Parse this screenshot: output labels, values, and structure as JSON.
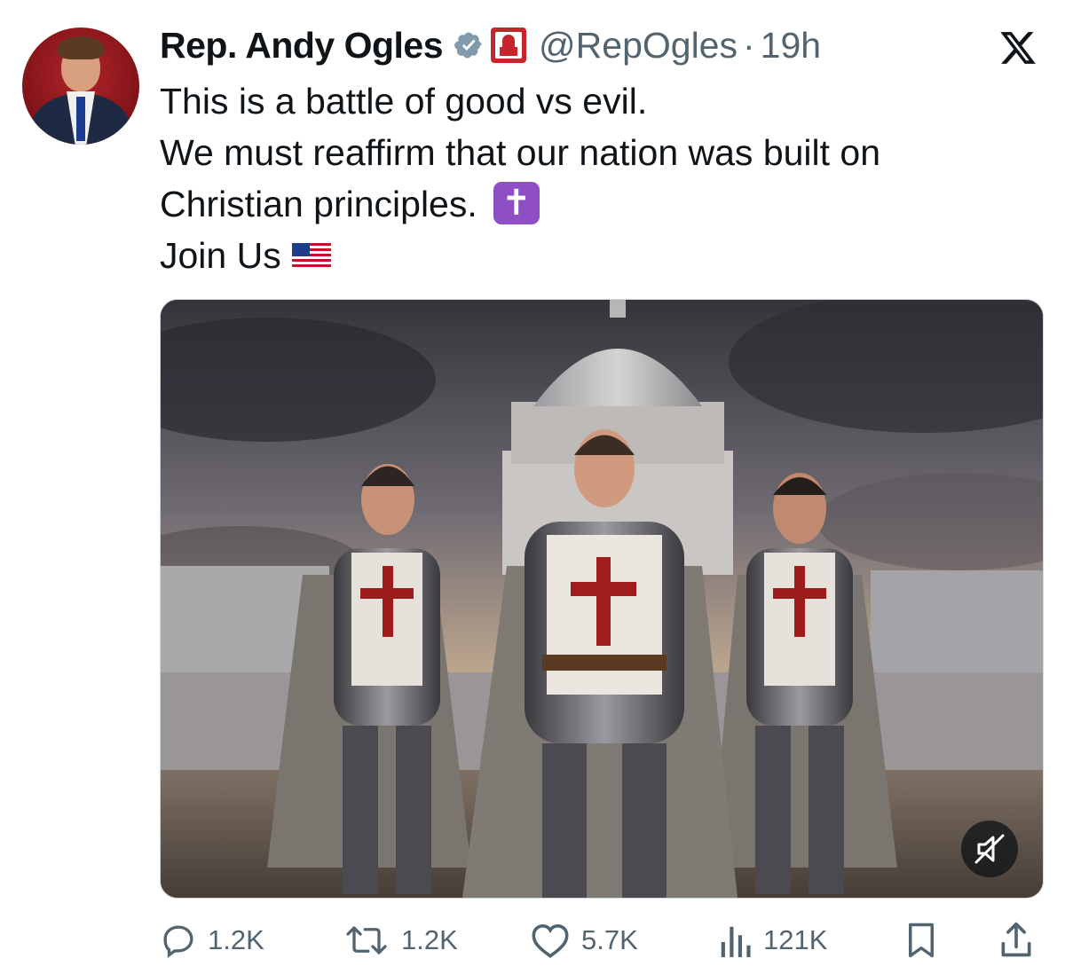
{
  "author": {
    "name": "Rep. Andy Ogles",
    "handle": "@RepOgles",
    "separator": "·",
    "time": "19h"
  },
  "tweet": {
    "lines": [
      "This is a battle of good vs evil.",
      "We must reaffirm that our nation was built on",
      "Christian principles.",
      "Join Us"
    ],
    "emoji_cross": "✝",
    "emoji_flag": "us-flag-emoji"
  },
  "media": {
    "type": "video",
    "mute_icon": "muted-speaker-icon"
  },
  "actions": {
    "replies": "1.2K",
    "reposts": "1.2K",
    "likes": "5.7K",
    "views": "121K"
  },
  "colors": {
    "text": "#0f1419",
    "secondary": "#536471",
    "verified": "#829aab",
    "cross_emoji_bg": "#8e4fc4",
    "org_badge": "#c8242b"
  }
}
